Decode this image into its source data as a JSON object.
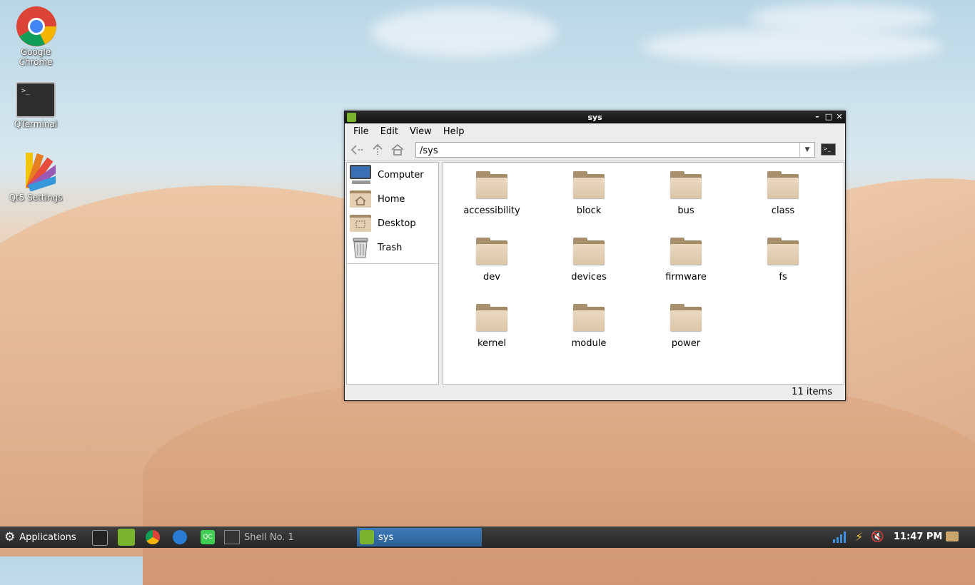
{
  "desktop": {
    "icons": [
      {
        "label": "Google Chrome",
        "icon": "chrome-icon"
      },
      {
        "label": "QTerminal",
        "icon": "terminal-icon"
      },
      {
        "label": "Qt5 Settings",
        "icon": "settings-palette-icon"
      }
    ]
  },
  "window": {
    "title": "sys",
    "menu": [
      "File",
      "Edit",
      "View",
      "Help"
    ],
    "path": "/sys",
    "sidebar": [
      {
        "label": "Computer",
        "icon": "computer-icon"
      },
      {
        "label": "Home",
        "icon": "home-folder-icon"
      },
      {
        "label": "Desktop",
        "icon": "desktop-folder-icon"
      },
      {
        "label": "Trash",
        "icon": "trash-icon"
      }
    ],
    "files": [
      "accessibility",
      "block",
      "bus",
      "class",
      "dev",
      "devices",
      "firmware",
      "fs",
      "kernel",
      "module",
      "power"
    ],
    "status": "11 items"
  },
  "taskbar": {
    "start_label": "Applications",
    "tasks": [
      {
        "label": "Shell No. 1",
        "icon": "terminal-icon"
      },
      {
        "label": "sys",
        "icon": "file-manager-icon"
      }
    ],
    "clock": "11:47 PM"
  }
}
